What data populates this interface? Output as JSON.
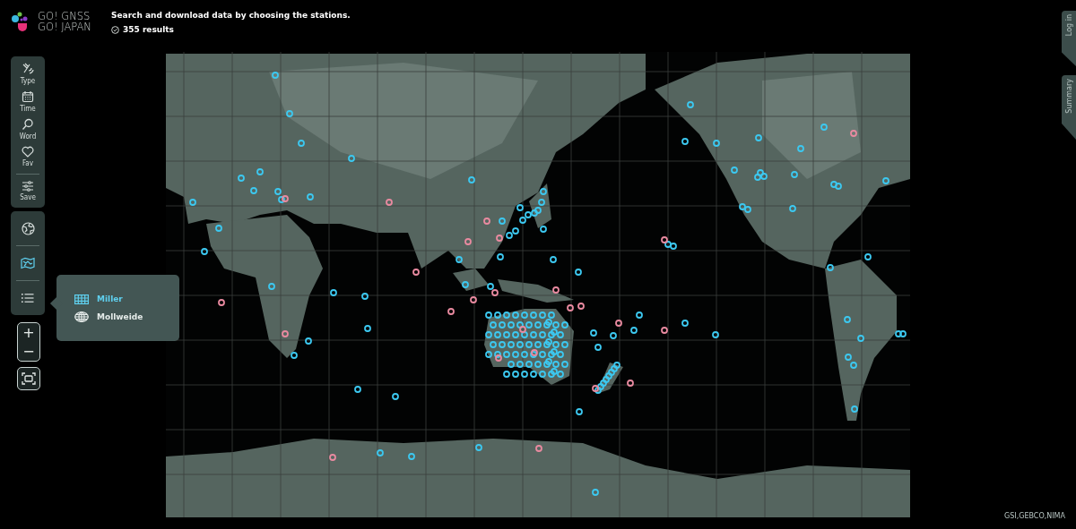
{
  "header": {
    "logo_lines": [
      "GO! GNSS",
      "GO! JAPAN"
    ],
    "instruction": "Search and download data by choosing the stations.",
    "result_count": "355 results"
  },
  "filter_buttons": [
    {
      "label": "Type",
      "kind": "type"
    },
    {
      "label": "Time",
      "kind": "time"
    },
    {
      "label": "Word",
      "kind": "word"
    },
    {
      "label": "Fav",
      "kind": "fav"
    }
  ],
  "save_button": {
    "label": "Save"
  },
  "view_buttons": [
    {
      "kind": "globe",
      "selected": false
    },
    {
      "kind": "map",
      "selected": true
    },
    {
      "kind": "list",
      "selected": false
    }
  ],
  "projection_menu": {
    "items": [
      {
        "label": "Miller",
        "kind": "grid",
        "selected": true
      },
      {
        "label": "Mollweide",
        "kind": "globe",
        "selected": false
      }
    ]
  },
  "zoom": {
    "in": "+",
    "out": "−"
  },
  "side_tabs": [
    {
      "label": "Log in"
    },
    {
      "label": "Summary"
    }
  ],
  "attribution": "GSI,GEBCO,NIMA"
}
